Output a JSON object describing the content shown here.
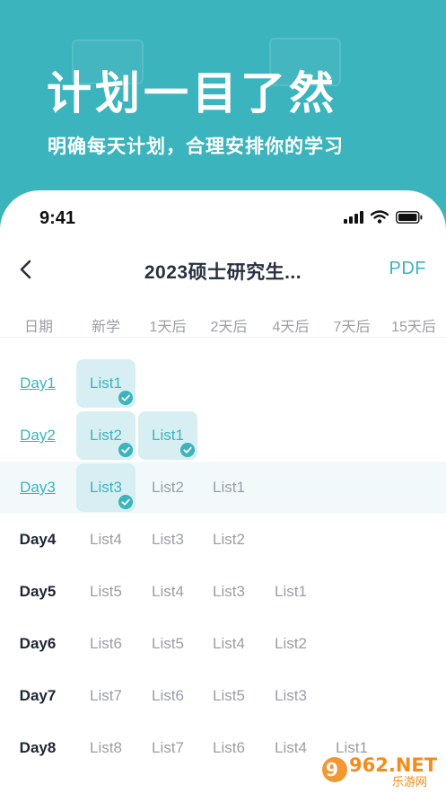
{
  "banner": {
    "headline": "计划一目了然",
    "subline": "明确每天计划，合理安排你的学习"
  },
  "status": {
    "time": "9:41"
  },
  "nav": {
    "title": "2023硕士研究生...",
    "pdf": "PDF"
  },
  "columns": [
    "日期",
    "新学",
    "1天后",
    "2天后",
    "4天后",
    "7天后",
    "15天后"
  ],
  "rows": [
    {
      "day": "Day1",
      "done": true,
      "highlight": false,
      "cells": [
        {
          "label": "List1",
          "checked": true
        }
      ]
    },
    {
      "day": "Day2",
      "done": true,
      "highlight": false,
      "cells": [
        {
          "label": "List2",
          "checked": true
        },
        {
          "label": "List1",
          "checked": true
        }
      ]
    },
    {
      "day": "Day3",
      "done": true,
      "highlight": true,
      "cells": [
        {
          "label": "List3",
          "checked": true
        },
        {
          "label": "List2",
          "checked": false
        },
        {
          "label": "List1",
          "checked": false
        }
      ]
    },
    {
      "day": "Day4",
      "done": false,
      "highlight": false,
      "cells": [
        {
          "label": "List4",
          "checked": false
        },
        {
          "label": "List3",
          "checked": false
        },
        {
          "label": "List2",
          "checked": false
        }
      ]
    },
    {
      "day": "Day5",
      "done": false,
      "highlight": false,
      "cells": [
        {
          "label": "List5",
          "checked": false
        },
        {
          "label": "List4",
          "checked": false
        },
        {
          "label": "List3",
          "checked": false
        },
        {
          "label": "List1",
          "checked": false
        }
      ]
    },
    {
      "day": "Day6",
      "done": false,
      "highlight": false,
      "cells": [
        {
          "label": "List6",
          "checked": false
        },
        {
          "label": "List5",
          "checked": false
        },
        {
          "label": "List4",
          "checked": false
        },
        {
          "label": "List2",
          "checked": false
        }
      ]
    },
    {
      "day": "Day7",
      "done": false,
      "highlight": false,
      "cells": [
        {
          "label": "List7",
          "checked": false
        },
        {
          "label": "List6",
          "checked": false
        },
        {
          "label": "List5",
          "checked": false
        },
        {
          "label": "List3",
          "checked": false
        }
      ]
    },
    {
      "day": "Day8",
      "done": false,
      "highlight": false,
      "cells": [
        {
          "label": "List8",
          "checked": false
        },
        {
          "label": "List7",
          "checked": false
        },
        {
          "label": "List6",
          "checked": false
        },
        {
          "label": "List4",
          "checked": false
        },
        {
          "label": "List1",
          "checked": false
        }
      ]
    }
  ],
  "watermark": {
    "brand": "962.NET",
    "sub": "乐游网"
  },
  "colors": {
    "accent": "#3cb4bd",
    "chip_bg": "#d7eff2",
    "muted_text": "#9a9ea6",
    "row_highlight": "#f1f9fb"
  },
  "icons": [
    "back-chevron-icon",
    "signal-icon",
    "wifi-icon",
    "battery-icon",
    "check-icon"
  ]
}
